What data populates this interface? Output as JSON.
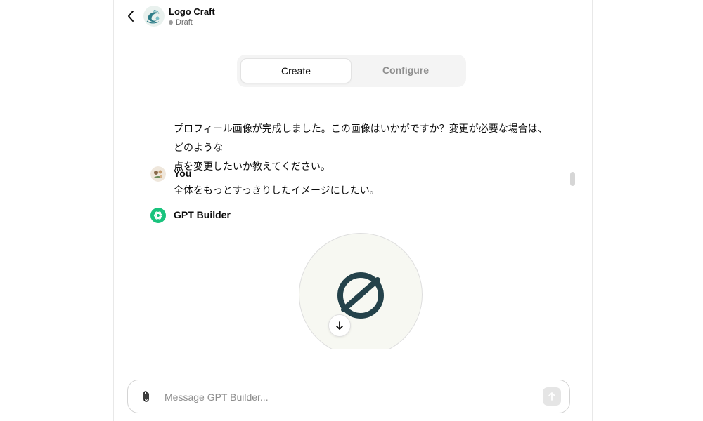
{
  "header": {
    "gpt_name": "Logo Craft",
    "status": "Draft"
  },
  "tabs": [
    {
      "label": "Create",
      "active": true
    },
    {
      "label": "Configure",
      "active": false
    }
  ],
  "conversation": {
    "assistant_message_lines": [
      "プロフィール画像が完成しました。この画像はいかがですか？変更が必要な場合は、どのような",
      "点を変更したいか教えてください。"
    ],
    "user": {
      "name": "You",
      "message": "全体をもっとすっきりしたイメージにしたい。"
    },
    "builder": {
      "name": "GPT Builder"
    }
  },
  "composer": {
    "placeholder": "Message GPT Builder...",
    "value": ""
  },
  "colors": {
    "accent_green": "#19c37d",
    "logo_dark": "#24424a"
  }
}
